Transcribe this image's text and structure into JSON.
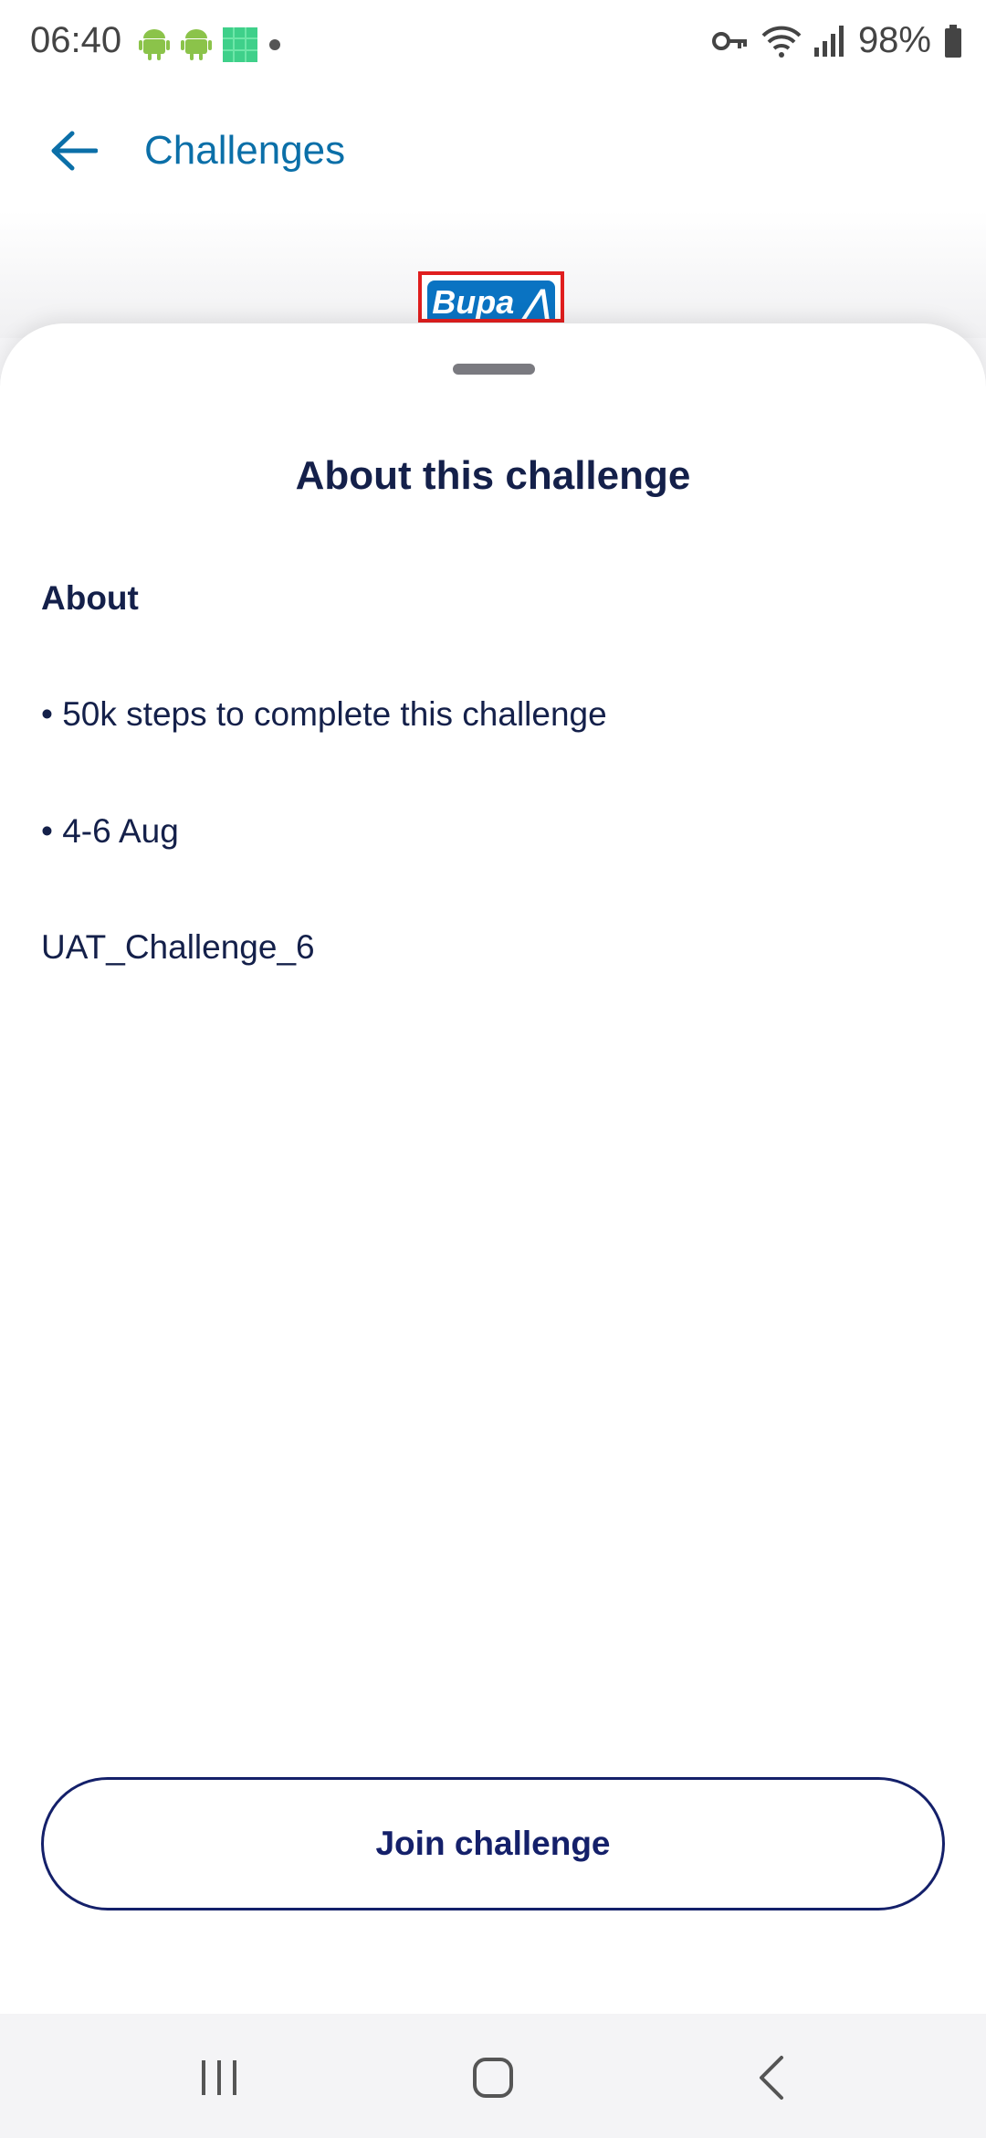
{
  "status_bar": {
    "time": "06:40",
    "battery": "98%",
    "icons": [
      "android-icon",
      "android-icon",
      "app-grid-icon",
      "dot-icon",
      "key-icon",
      "wifi-icon",
      "signal-icon",
      "battery-icon"
    ]
  },
  "app_bar": {
    "title": "Challenges",
    "back_icon": "arrow-left-icon"
  },
  "hero": {
    "logo_text": "Bupa ⋀"
  },
  "sheet": {
    "title": "About this challenge",
    "section_heading": "About",
    "bullets": [
      "• 50k steps to complete this challenge",
      "• 4-6 Aug"
    ],
    "challenge_name": "UAT_Challenge_6",
    "join_label": "Join challenge"
  },
  "nav_bar": {
    "icons": [
      "recent-apps-icon",
      "home-icon",
      "back-icon"
    ]
  },
  "colors": {
    "title_blue": "#0b6fa8",
    "text_navy": "#14204a",
    "button_border": "#14206a",
    "logo_blue": "#0a73c2",
    "highlight_red": "#e01e1e"
  }
}
